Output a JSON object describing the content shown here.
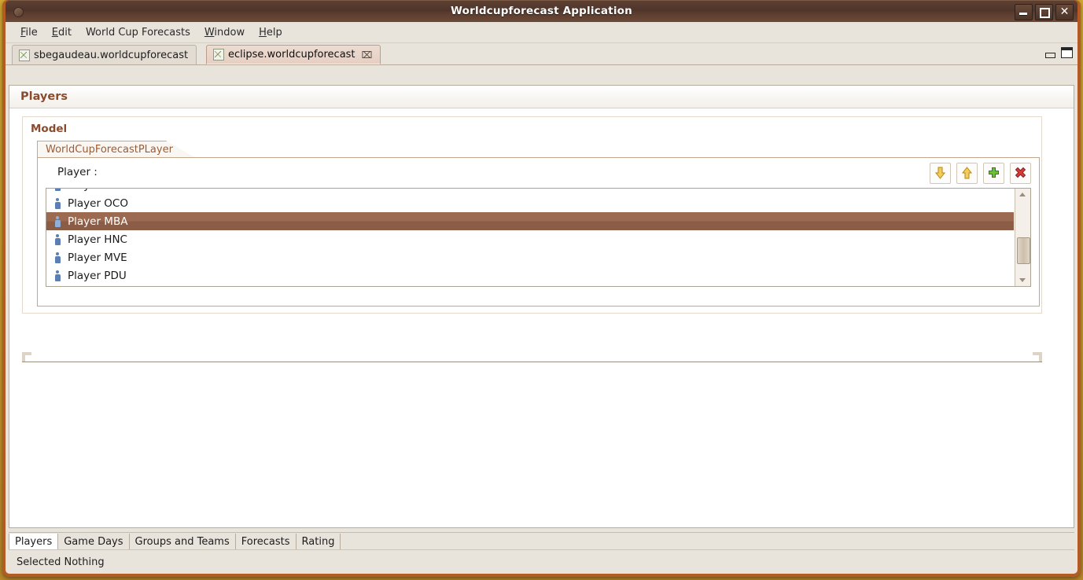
{
  "window": {
    "title": "Worldcupforecast Application",
    "controls": {
      "minimize": "minimize-window",
      "maximize": "maximize-window",
      "close": "close-window"
    }
  },
  "menubar": {
    "items": [
      {
        "label": "File",
        "mnemonic": "F"
      },
      {
        "label": "Edit",
        "mnemonic": "E"
      },
      {
        "label": "World Cup Forecasts",
        "mnemonic": ""
      },
      {
        "label": "Window",
        "mnemonic": "W"
      },
      {
        "label": "Help",
        "mnemonic": "H"
      }
    ]
  },
  "editor_tabs": {
    "items": [
      {
        "label": "sbegaudeau.worldcupforecast",
        "active": false,
        "closable": false
      },
      {
        "label": "eclipse.worldcupforecast",
        "active": true,
        "closable": true
      }
    ],
    "close_glyph": "⌧"
  },
  "form": {
    "title": "Players",
    "section": {
      "label": "Model",
      "tab_label": "WorldCupForecastPLayer",
      "field_label": "Player :",
      "toolbar": [
        {
          "name": "move-down-button",
          "icon": "arrow-down-icon",
          "color": "#e8b63c"
        },
        {
          "name": "move-up-button",
          "icon": "arrow-up-icon",
          "color": "#e8b63c"
        },
        {
          "name": "add-button",
          "icon": "plus-icon",
          "color": "#62a83b"
        },
        {
          "name": "delete-button",
          "icon": "delete-x-icon",
          "color": "#cc3333"
        }
      ],
      "players": [
        {
          "label": "Player OCO",
          "selected": false
        },
        {
          "label": "Player MBA",
          "selected": true
        },
        {
          "label": "Player HNC",
          "selected": false
        },
        {
          "label": "Player MVE",
          "selected": false
        },
        {
          "label": "Player PDU",
          "selected": false
        }
      ]
    }
  },
  "bottom_tabs": {
    "items": [
      {
        "label": "Players",
        "active": true
      },
      {
        "label": "Game Days",
        "active": false
      },
      {
        "label": "Groups and Teams",
        "active": false
      },
      {
        "label": "Forecasts",
        "active": false
      },
      {
        "label": "Rating",
        "active": false
      }
    ]
  },
  "statusbar": {
    "text": "Selected Nothing"
  },
  "colors": {
    "accent": "#8a4b2e",
    "selection": "#9c6a51",
    "window_frame": "#b45b25",
    "desktop": "#c79a2c"
  }
}
